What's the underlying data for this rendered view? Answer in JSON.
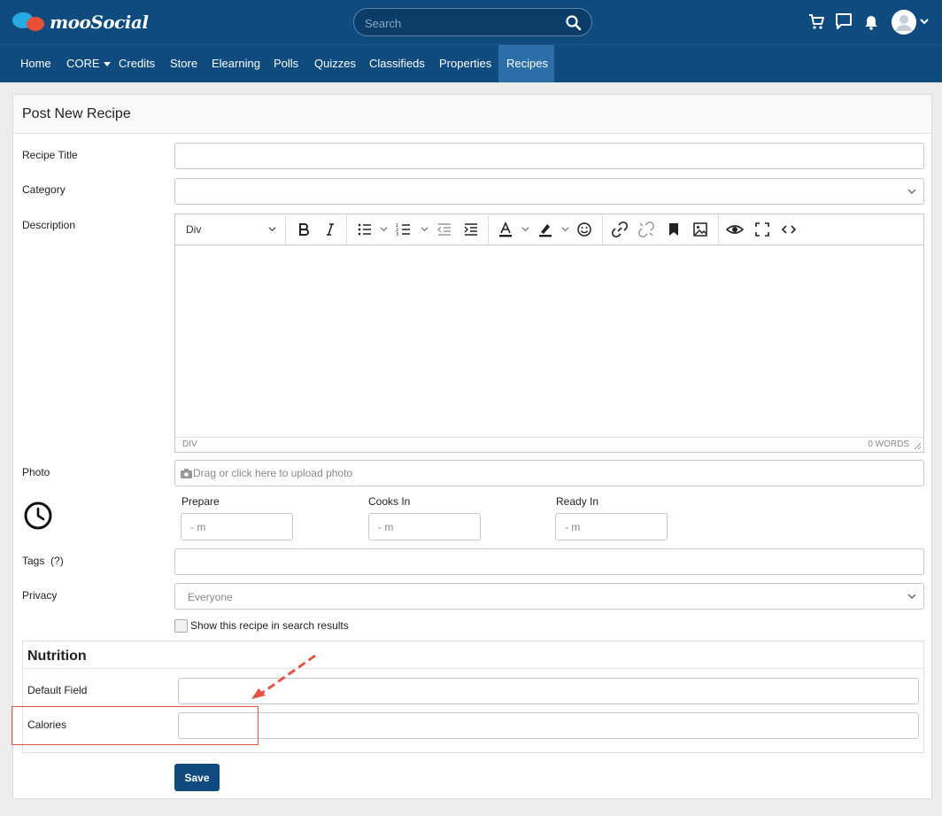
{
  "header": {
    "logo_text": "mooSocial",
    "search_placeholder": "Search"
  },
  "nav": {
    "items": [
      {
        "label": "Home"
      },
      {
        "label": "CORE"
      },
      {
        "label": "Credits"
      },
      {
        "label": "Store"
      },
      {
        "label": "Elearning"
      },
      {
        "label": "Polls"
      },
      {
        "label": "Quizzes"
      },
      {
        "label": "Classifieds"
      },
      {
        "label": "Properties"
      },
      {
        "label": "Recipes"
      }
    ],
    "active": "Recipes"
  },
  "form": {
    "title": "Post New Recipe",
    "recipe_title_label": "Recipe Title",
    "category_label": "Category",
    "description_label": "Description",
    "editor": {
      "format_value": "Div",
      "status_path": "DIV",
      "word_count": "0 WORDS"
    },
    "photo_label": "Photo",
    "photo_placeholder": "Drag or click here to upload photo",
    "prepare_label": "Prepare",
    "cooks_in_label": "Cooks In",
    "ready_in_label": "Ready In",
    "time_placeholder": "- m",
    "tags_label": "Tags",
    "tags_help": "(?)",
    "privacy_label": "Privacy",
    "privacy_value": "Everyone",
    "search_checkbox_label": "Show this recipe in search results",
    "nutrition": {
      "title": "Nutrition",
      "default_field_label": "Default Field",
      "calories_label": "Calories"
    },
    "save_label": "Save"
  },
  "colors": {
    "header_bg": "#0f4b7f",
    "active_tab": "#2b6ea8",
    "annotation": "#e05545"
  }
}
